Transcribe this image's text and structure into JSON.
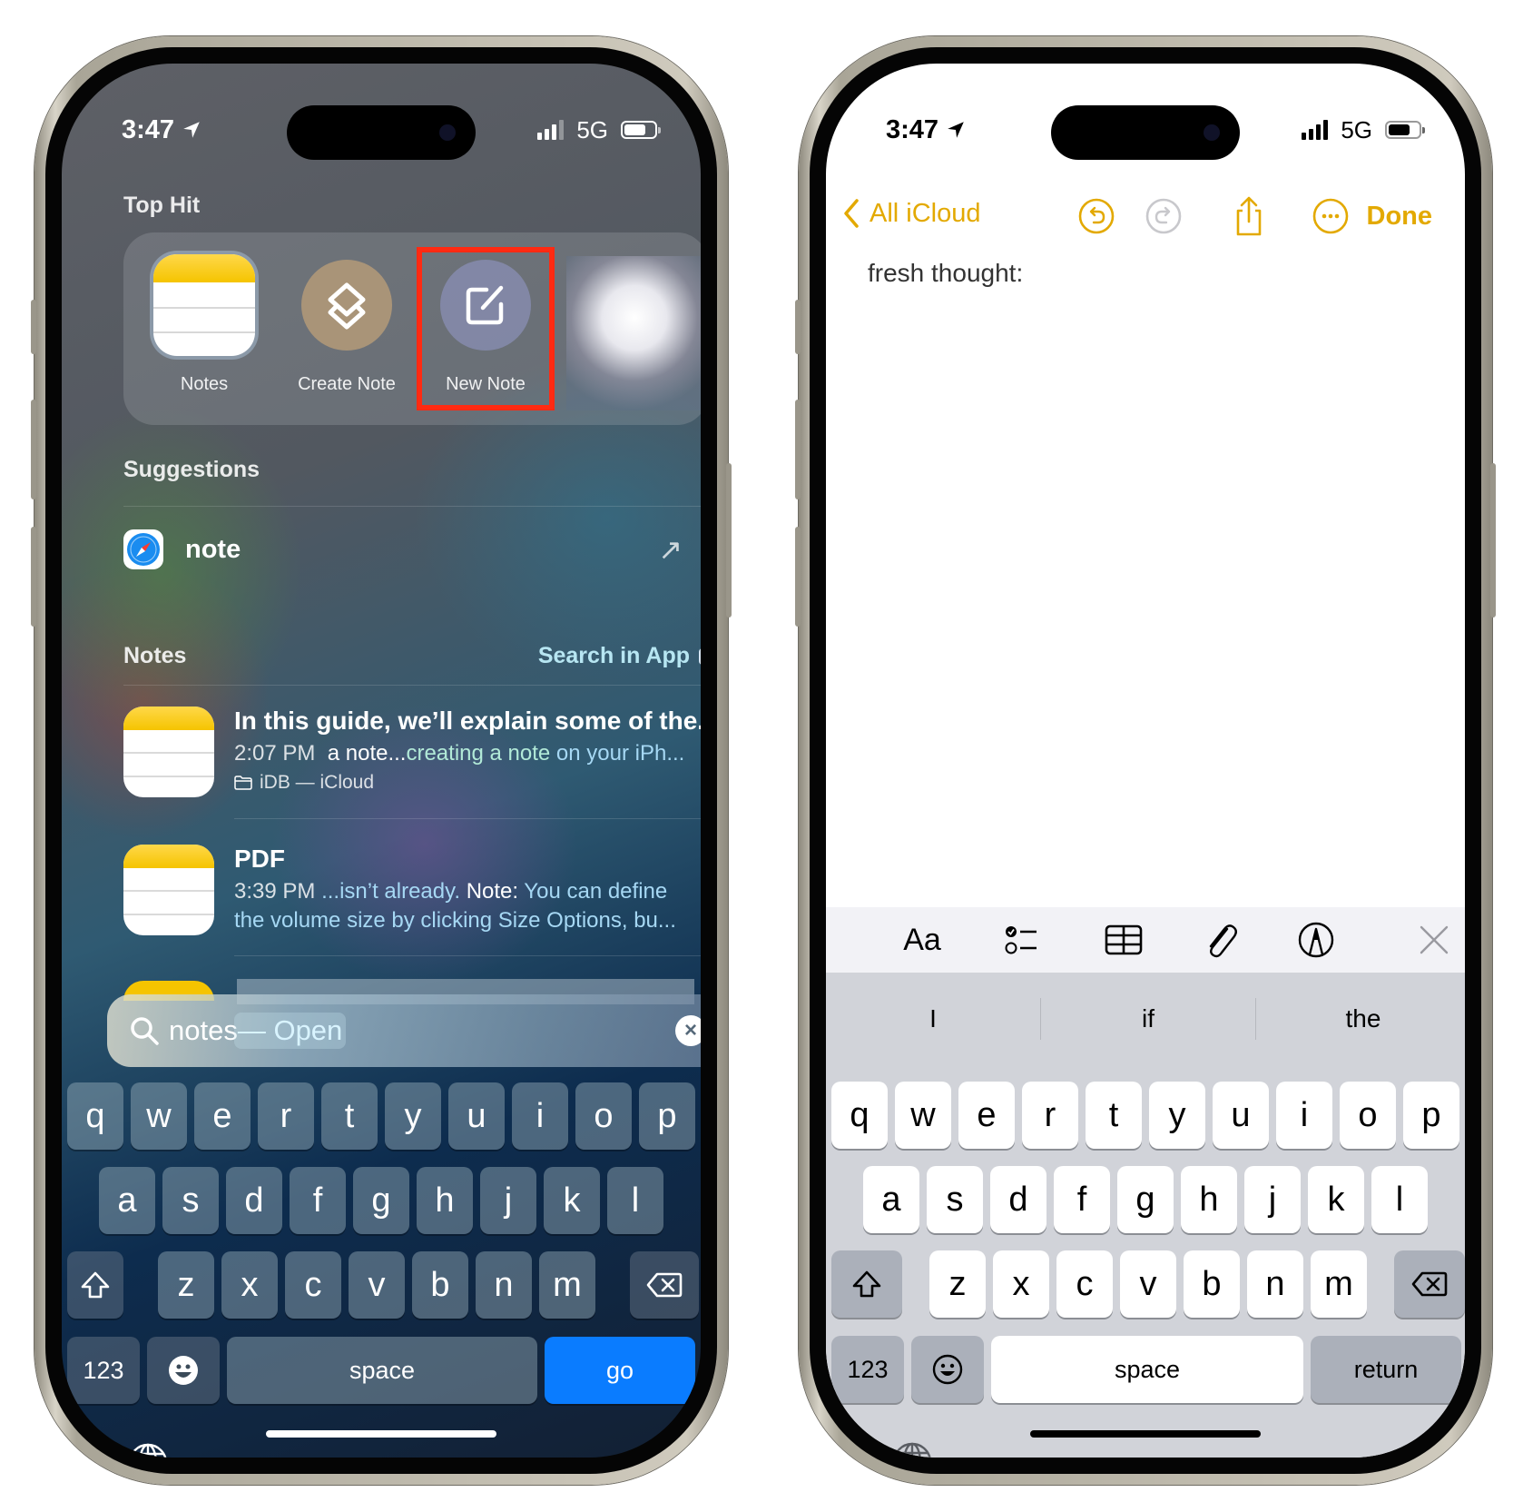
{
  "left_phone": {
    "status": {
      "time": "3:47",
      "network": "5G"
    },
    "top_hit": {
      "label": "Top Hit",
      "items": [
        {
          "label": "Notes",
          "icon": "notes-app-icon"
        },
        {
          "label": "Create Note",
          "icon": "shortcuts-icon"
        },
        {
          "label": "New Note",
          "icon": "compose-icon",
          "highlighted": true
        },
        {
          "label": "",
          "icon": "blurred-thumbnail"
        }
      ],
      "highlight_color": "#ff2a12"
    },
    "suggestions": {
      "label": "Suggestions",
      "items": [
        {
          "text": "note",
          "icon": "safari-icon",
          "action_icon": "arrow-up-right-icon"
        }
      ]
    },
    "notes_section": {
      "label": "Notes",
      "search_in_app": "Search in App",
      "results": [
        {
          "title": "In this guide, we’ll explain some of the...",
          "time": "2:07 PM",
          "snippet_plain": "a note...",
          "snippet_match": "creating a note",
          "snippet_rest": " on your iPh...",
          "folder": "iDB — iCloud"
        },
        {
          "title": "PDF",
          "time": "3:39 PM",
          "snippet_1": "...isn’t already.",
          "snippet_bold": "Note:",
          "snippet_2": "You can define",
          "snippet_line2": "the volume size by clicking Size Options, bu..."
        }
      ]
    },
    "search": {
      "query": "notes",
      "completion": "— Open"
    },
    "keyboard": {
      "row1": [
        "q",
        "w",
        "e",
        "r",
        "t",
        "y",
        "u",
        "i",
        "o",
        "p"
      ],
      "row2": [
        "a",
        "s",
        "d",
        "f",
        "g",
        "h",
        "j",
        "k",
        "l"
      ],
      "row3": [
        "z",
        "x",
        "c",
        "v",
        "b",
        "n",
        "m"
      ],
      "numbers_label": "123",
      "space_label": "space",
      "action_label": "go",
      "action_color": "#0a7cff"
    }
  },
  "right_phone": {
    "status": {
      "time": "3:47",
      "network": "5G"
    },
    "nav": {
      "back_label": "All iCloud",
      "done_label": "Done",
      "accent": "#e3a900"
    },
    "note_body": "fresh thought:",
    "format_bar": {
      "text_style_label": "Aa"
    },
    "predictions": [
      "I",
      "if",
      "the"
    ],
    "keyboard": {
      "row1": [
        "q",
        "w",
        "e",
        "r",
        "t",
        "y",
        "u",
        "i",
        "o",
        "p"
      ],
      "row2": [
        "a",
        "s",
        "d",
        "f",
        "g",
        "h",
        "j",
        "k",
        "l"
      ],
      "row3": [
        "z",
        "x",
        "c",
        "v",
        "b",
        "n",
        "m"
      ],
      "numbers_label": "123",
      "space_label": "space",
      "action_label": "return"
    }
  }
}
